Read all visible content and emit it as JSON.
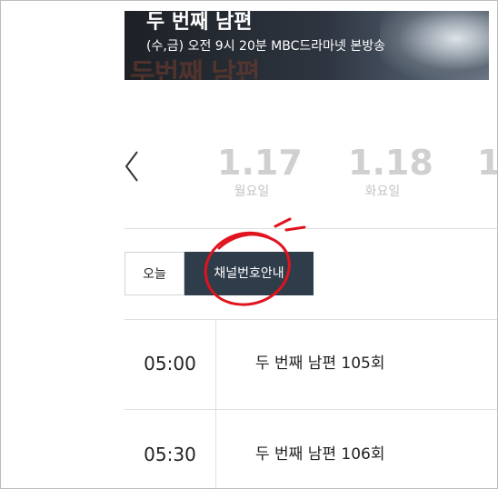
{
  "banner": {
    "title": "두 번째 남편",
    "subtitle": "(수,금) 오전 9시 20분 MBC드라마넷 본방송",
    "bg_text": "두번째 남편"
  },
  "date_nav": {
    "prev_icon": "chevron-left-icon",
    "dates": [
      {
        "date": "1.17",
        "weekday": "월요일"
      },
      {
        "date": "1.18",
        "weekday": "화요일"
      },
      {
        "date": "1",
        "weekday": ""
      }
    ]
  },
  "tabs": {
    "today": "오늘",
    "channel_guide": "채널번호안내"
  },
  "schedule": [
    {
      "time": "05:00",
      "program": "두 번째 남편 105회"
    },
    {
      "time": "05:30",
      "program": "두 번째 남편 106회"
    }
  ],
  "colors": {
    "tab_active_bg": "#2f3c4a",
    "annotation": "#e0141e",
    "date_inactive": "#d0d0d0"
  }
}
